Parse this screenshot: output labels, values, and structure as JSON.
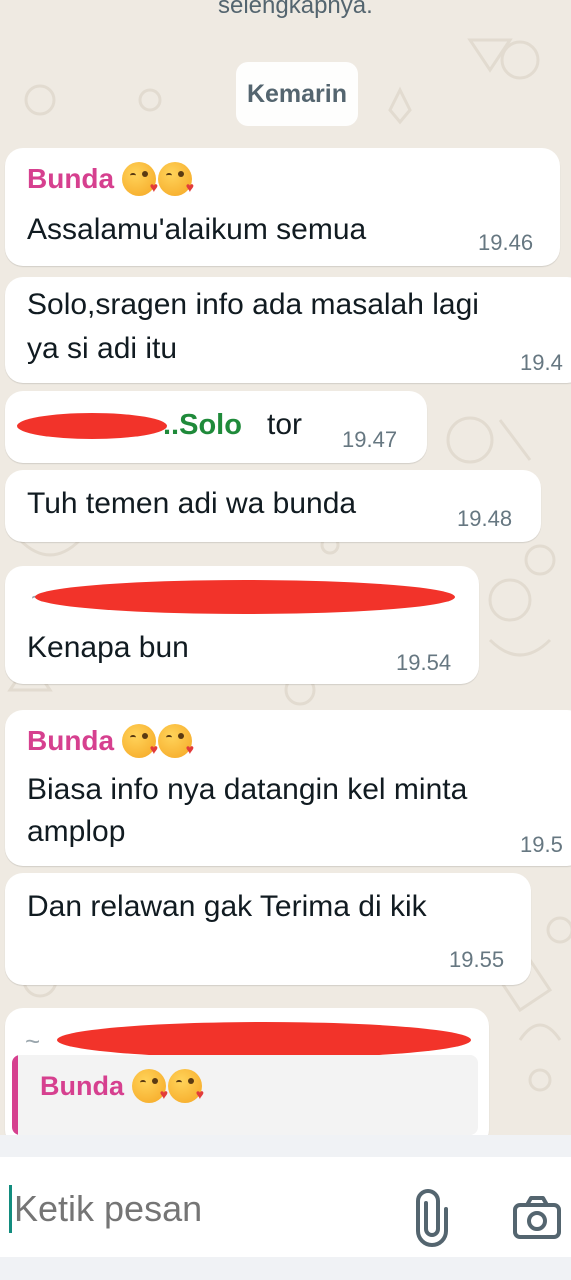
{
  "top_preview": {
    "text": "selengkapnya."
  },
  "date_separator": "Kemarin",
  "messages": [
    {
      "sender": "Bunda",
      "text": "Assalamu'alaikum semua",
      "time": "19.46"
    },
    {
      "line1": "Solo,sragen info ada masalah lagi",
      "line2": "ya si adi itu",
      "time": "19.4"
    },
    {
      "sender_visible": "..Solo",
      "text": "tor",
      "time": "19.47"
    },
    {
      "text": "Tuh temen adi wa bunda",
      "time": "19.48"
    },
    {
      "text": "Kenapa bun",
      "time": "19.54"
    },
    {
      "sender": "Bunda",
      "line1": "Biasa info nya datangin kel minta",
      "line2": "amplop",
      "time": "19.5"
    },
    {
      "text": "Dan relawan gak Terima di kik",
      "time": "19.55"
    },
    {
      "tilde": "~",
      "quote_sender": "Bunda"
    }
  ],
  "composer": {
    "placeholder": "Ketik pesan",
    "icons": [
      "attach-icon",
      "camera-icon"
    ]
  },
  "colors": {
    "background": "#efeae2",
    "bubble": "#ffffff",
    "sender_pink": "#d6408f",
    "sender_green": "#1f8a3a",
    "redaction": "#f2332a",
    "timestamp": "#667781"
  }
}
